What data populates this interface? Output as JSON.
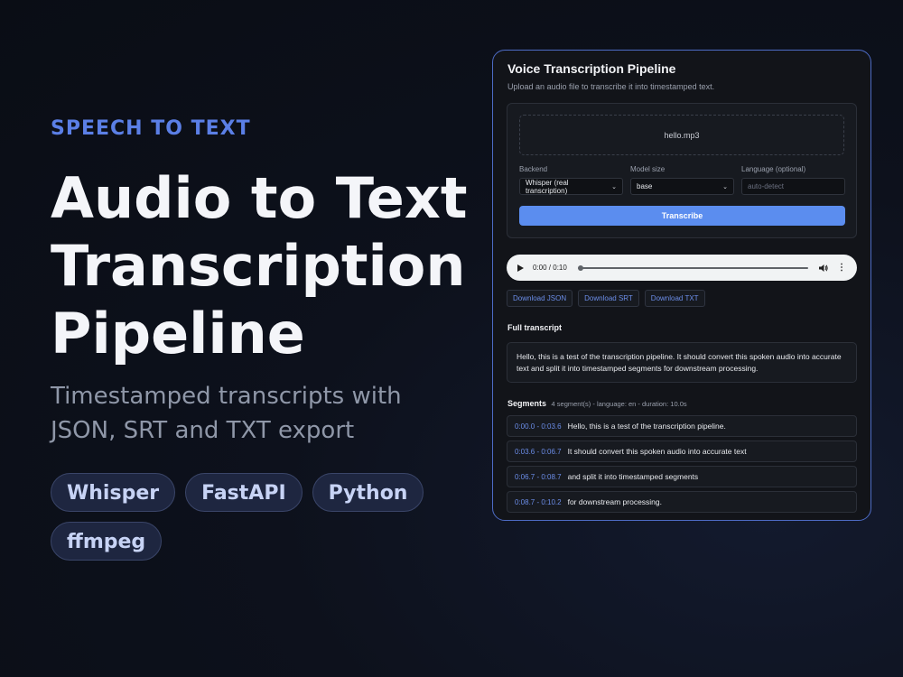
{
  "hero": {
    "kicker": "SPEECH TO TEXT",
    "title_lines": [
      "Audio to Text",
      "Transcription",
      "Pipeline"
    ],
    "subtitle": "Timestamped transcripts with JSON, SRT and TXT export",
    "tags": [
      "Whisper",
      "FastAPI",
      "Python",
      "ffmpeg"
    ]
  },
  "app": {
    "title": "Voice Transcription Pipeline",
    "description": "Upload an audio file to transcribe it into timestamped text.",
    "file_name": "hello.mp3",
    "backend": {
      "label": "Backend",
      "value": "Whisper (real transcription)"
    },
    "model": {
      "label": "Model size",
      "value": "base"
    },
    "language": {
      "label": "Language (optional)",
      "placeholder": "auto-detect"
    },
    "transcribe_label": "Transcribe",
    "audio": {
      "time": "0:00 / 0:10",
      "progress": 0
    },
    "downloads": [
      "Download JSON",
      "Download SRT",
      "Download TXT"
    ],
    "full_transcript_title": "Full transcript",
    "full_transcript": "Hello, this is a test of the transcription pipeline. It should convert this spoken audio into accurate text and split it into timestamped segments for downstream processing.",
    "segments_title": "Segments",
    "segments_meta": "4 segment(s) - language: en - duration: 10.0s",
    "segments": [
      {
        "time": "0:00.0 - 0:03.6",
        "text": "Hello, this is a test of the transcription pipeline."
      },
      {
        "time": "0:03.6 - 0:06.7",
        "text": "It should convert this spoken audio into accurate text"
      },
      {
        "time": "0:06.7 - 0:08.7",
        "text": "and split it into timestamped segments"
      },
      {
        "time": "0:08.7 - 0:10.2",
        "text": "for downstream processing."
      }
    ]
  },
  "colors": {
    "accent": "#5b7fe6",
    "button": "#5b8def",
    "window_border": "#4d6bc4",
    "background": "#0d111c"
  },
  "icons": [
    "play-icon",
    "volume-icon",
    "more-vert-icon",
    "chevron-down-icon"
  ]
}
